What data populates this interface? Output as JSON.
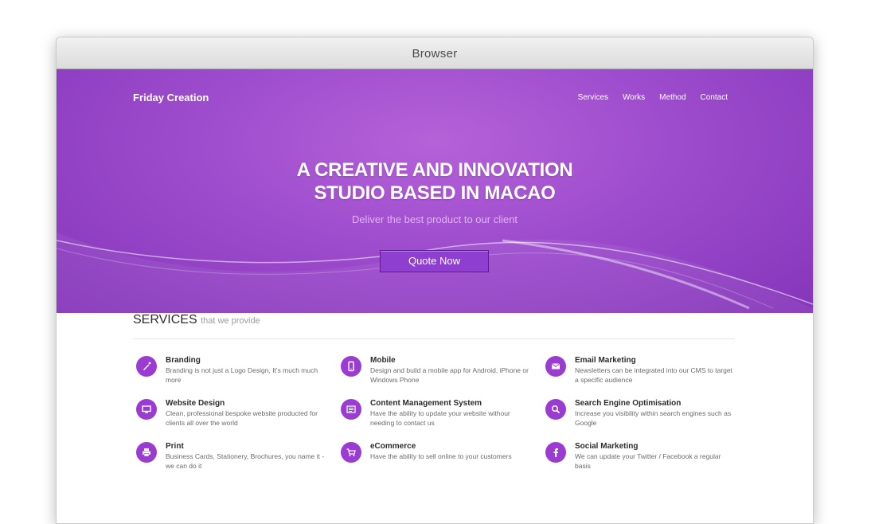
{
  "window": {
    "title": "Browser"
  },
  "header": {
    "brand": "Friday Creation",
    "nav": [
      "Services",
      "Works",
      "Method",
      "Contact"
    ]
  },
  "hero": {
    "headline_1": "A CREATIVE AND INNOVATION",
    "headline_2": "STUDIO BASED IN MACAO",
    "subline": "Deliver the best product to our client",
    "cta": "Quote Now"
  },
  "services": {
    "title": "SERVICES",
    "subtitle": "that we provide",
    "items": [
      {
        "icon": "pen-icon",
        "title": "Branding",
        "desc": "Branding is not just a Logo Design, It's much much more"
      },
      {
        "icon": "mobile-icon",
        "title": "Mobile",
        "desc": "Design and build a mobile app for Android, iPhone or Windows Phone"
      },
      {
        "icon": "mail-icon",
        "title": "Email Marketing",
        "desc": "Newsletters can be integrated into our CMS to target a specific audience"
      },
      {
        "icon": "monitor-icon",
        "title": "Website Design",
        "desc": "Clean, professional bespoke website producted for clients all over the world"
      },
      {
        "icon": "list-icon",
        "title": "Content Management System",
        "desc": "Have the ability to update your website withour needing to contact us"
      },
      {
        "icon": "search-icon",
        "title": "Search Engine Optimisation",
        "desc": "Increase you visibility within search engines such as Google"
      },
      {
        "icon": "printer-icon",
        "title": "Print",
        "desc": "Business Cards, Stationery, Brochures, you name it - we can do it"
      },
      {
        "icon": "cart-icon",
        "title": "eCommerce",
        "desc": "Have the ability to sell online to your customers"
      },
      {
        "icon": "facebook-icon",
        "title": "Social Marketing",
        "desc": "We can update your Twitter / Facebook a regular basis"
      }
    ]
  },
  "colors": {
    "accent": "#9a3bd2",
    "hero": "#9d4ccd",
    "button": "#8e3fcf"
  }
}
